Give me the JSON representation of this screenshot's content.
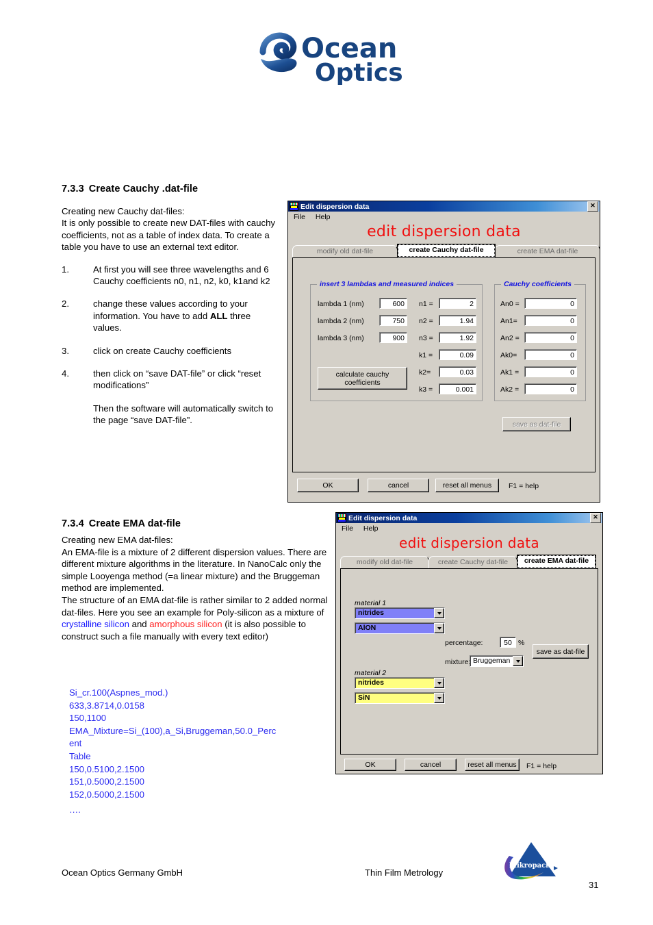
{
  "document": {
    "logo_alt": "Ocean Optics",
    "section1": {
      "number": "7.3.3",
      "title": "Create Cauchy .dat-file",
      "intro": "Creating new Cauchy dat-files:\nIt is only possible to create new DAT-files with cauchy coefficients, not as a table of index data. To create a table you have to use an external text editor.",
      "steps": [
        {
          "marker": "1.",
          "text": "At first you will see three wavelengths and 6 Cauchy coefficients n0, n1, n2, k0, k1and k2"
        },
        {
          "marker": "2.",
          "text_a": "change these values according to your information. You have to add ",
          "bold": "ALL",
          "text_b": " three values."
        },
        {
          "marker": "3.",
          "text": "click on create Cauchy coefficients"
        },
        {
          "marker": "4.",
          "text": "then click on “save DAT-file” or click “reset modifications”"
        }
      ],
      "followup": "Then the software will automatically switch to the page “save DAT-file”."
    },
    "section2": {
      "number": "7.3.4",
      "title": "Create EMA dat-file",
      "para_a": "Creating new EMA dat-files:\nAn EMA-file is a mixture of 2 different dispersion values. There are different mixture algorithms in the literature. In NanoCalc only the simple Looyenga method (=a linear mixture) and the Bruggeman method are implemented.",
      "para_b_1": "The structure of an EMA dat-file is rather similar to 2 added normal dat-files. Here you see an example for Poly-silicon as a mixture of ",
      "para_b_blue": "crystalline silicon",
      "para_b_2": " and ",
      "para_b_red": "amorphous silicon",
      "para_b_3": " (it is also possible to construct such a file manually with every text editor)",
      "code_lines": [
        "Si_cr.100(Aspnes_mod.)",
        "633,3.8714,0.0158",
        "150,1100",
        "EMA_Mixture=Si_(100),a_Si,Bruggeman,50.0_Perc",
        "ent",
        "Table",
        "150,0.5100,2.1500",
        "151,0.5000,2.1500",
        "152,0.5000,2.1500",
        "…."
      ]
    },
    "footer": {
      "left": "Ocean Optics Germany GmbH",
      "middle": "Thin Film Metrology",
      "page_number": "31",
      "logo_text": "Mikropack"
    },
    "colors": {
      "heading_red": "#f01010",
      "link_blue": "#1414ff",
      "link_red": "#ff2020",
      "code_blue": "#2c2cf0",
      "dialog_face": "#d4d0c8",
      "title_blue": "#0a246a",
      "material1_bg": "#8080f8",
      "material2_bg": "#ffff80"
    }
  },
  "dialog_cauchy": {
    "title": "Edit dispersion data",
    "close_label": "✕",
    "menu": [
      "File",
      "Help"
    ],
    "heading": "edit dispersion data",
    "tabs": [
      {
        "label": "modify  old dat-file",
        "active": false
      },
      {
        "label": "create Cauchy dat-file",
        "active": true
      },
      {
        "label": "create EMA dat-file",
        "active": false
      }
    ],
    "group_lambda": {
      "legend": "insert 3 lambdas and measured indices",
      "rows": [
        {
          "label": "lambda 1 (nm)",
          "value": "600"
        },
        {
          "label": "lambda 2 (nm)",
          "value": "750"
        },
        {
          "label": "lambda 3 (nm)",
          "value": "900"
        }
      ],
      "indices": [
        {
          "label": "n1 =",
          "value": "2"
        },
        {
          "label": "n2 =",
          "value": "1.94"
        },
        {
          "label": "n3 =",
          "value": "1.92"
        },
        {
          "label": "k1 =",
          "value": "0.09"
        },
        {
          "label": "k2=",
          "value": "0.03"
        },
        {
          "label": "k3 =",
          "value": "0.001"
        }
      ],
      "calc_button": "calculate cauchy\ncoefficients",
      "calc_button_l1": "calculate cauchy",
      "calc_button_l2": "coefficients"
    },
    "group_cauchy": {
      "legend": "Cauchy coefficients",
      "rows": [
        {
          "label": "An0 =",
          "value": "0"
        },
        {
          "label": "An1=",
          "value": "0"
        },
        {
          "label": "An2 =",
          "value": "0"
        },
        {
          "label": "Ak0=",
          "value": "0"
        },
        {
          "label": "Ak1 =",
          "value": "0"
        },
        {
          "label": "Ak2 =",
          "value": "0"
        }
      ]
    },
    "save_button": "save as dat-file",
    "save_button_enabled": false,
    "buttons": {
      "ok": "OK",
      "cancel": "cancel",
      "reset": "reset all menus",
      "help_hint": "F1 = help"
    }
  },
  "dialog_ema": {
    "title": "Edit dispersion data",
    "close_label": "✕",
    "menu": [
      "File",
      "Help"
    ],
    "heading": "edit dispersion data",
    "tabs": [
      {
        "label": "modify  old dat-file",
        "active": false
      },
      {
        "label": "create Cauchy dat-file",
        "active": false
      },
      {
        "label": "create EMA dat-file",
        "active": true
      }
    ],
    "material1": {
      "label": "material 1",
      "category": "nitrides",
      "item": "AlON"
    },
    "material2": {
      "label": "material 2",
      "category": "nitrides",
      "item": "SiN"
    },
    "percentage": {
      "label": "percentage:",
      "value": "50",
      "unit": "%"
    },
    "mixture": {
      "label": "mixture:",
      "value": "Bruggeman"
    },
    "save_button": "save as dat-file",
    "save_button_enabled": true,
    "buttons": {
      "ok": "OK",
      "cancel": "cancel",
      "reset": "reset all menus",
      "help_hint": "F1 = help"
    }
  }
}
